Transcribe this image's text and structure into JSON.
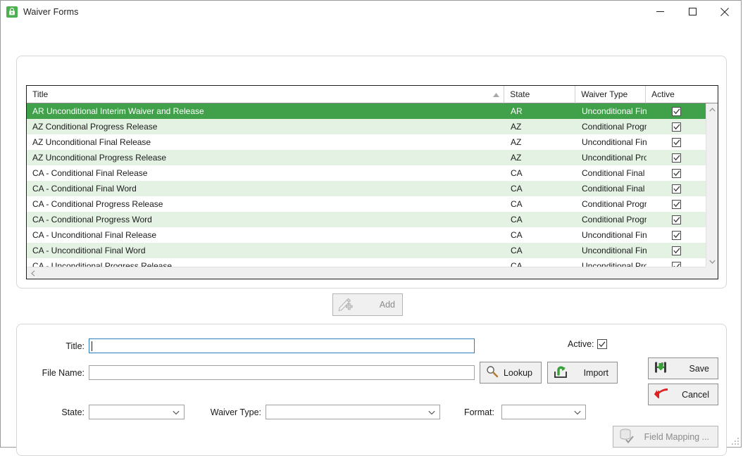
{
  "window": {
    "title": "Waiver Forms",
    "icon": "waiver-lock-icon",
    "minimize_label": "—",
    "maximize_label": "□",
    "close_label": "✕"
  },
  "grid": {
    "columns": [
      {
        "key": "title",
        "label": "Title",
        "sorted": true,
        "sort_dir": "asc"
      },
      {
        "key": "state",
        "label": "State",
        "sorted": false,
        "sort_dir": ""
      },
      {
        "key": "type",
        "label": "Waiver Type",
        "sorted": false,
        "sort_dir": ""
      },
      {
        "key": "active",
        "label": "Active",
        "sorted": false,
        "sort_dir": ""
      }
    ],
    "rows": [
      {
        "title": "AR Unconditional Interim Waiver and Release",
        "state": "AR",
        "type": "Unconditional Final",
        "active": true,
        "selected": true
      },
      {
        "title": "AZ Conditional Progress Release",
        "state": "AZ",
        "type": "Conditional Progr...",
        "active": true,
        "selected": false
      },
      {
        "title": "AZ Unconditional Final Release",
        "state": "AZ",
        "type": "Unconditional Final",
        "active": true,
        "selected": false
      },
      {
        "title": "AZ Unconditional Progress Release",
        "state": "AZ",
        "type": "Unconditional Pro...",
        "active": true,
        "selected": false
      },
      {
        "title": "CA - Conditional Final Release",
        "state": "CA",
        "type": "Conditional Final",
        "active": true,
        "selected": false
      },
      {
        "title": "CA - Conditional Final Word",
        "state": "CA",
        "type": "Conditional Final",
        "active": true,
        "selected": false
      },
      {
        "title": "CA - Conditional Progress Release",
        "state": "CA",
        "type": "Conditional Progr...",
        "active": true,
        "selected": false
      },
      {
        "title": "CA - Conditional Progress Word",
        "state": "CA",
        "type": "Conditional Progr...",
        "active": true,
        "selected": false
      },
      {
        "title": "CA - Unconditional Final Release",
        "state": "CA",
        "type": "Unconditional Final",
        "active": true,
        "selected": false
      },
      {
        "title": "CA - Unconditional Final Word",
        "state": "CA",
        "type": "Unconditional Final",
        "active": true,
        "selected": false
      },
      {
        "title": "CA - Unconditional Progress Release",
        "state": "CA",
        "type": "Unconditional Pro",
        "active": true,
        "selected": false
      }
    ],
    "selected_color": "#40a14a",
    "alt_row_color": "#e4f2e3"
  },
  "toolbar": {
    "add_label": "Add",
    "add_icon": "pen-plus-icon",
    "add_enabled": false
  },
  "form": {
    "title_label": "Title:",
    "title_value": "",
    "file_name_label": "File Name:",
    "file_name_value": "",
    "state_label": "State:",
    "state_value": "",
    "waiver_type_label": "Waiver Type:",
    "waiver_type_value": "",
    "format_label": "Format:",
    "format_value": "",
    "active_label": "Active:",
    "active_checked": true,
    "lookup_label": "Lookup",
    "lookup_icon": "magnifier-icon",
    "import_label": "Import",
    "import_icon": "import-arrow-icon",
    "save_label": "Save",
    "save_icon": "floppy-disk-icon",
    "cancel_label": "Cancel",
    "cancel_icon": "red-arrow-icon",
    "field_mapping_label": "Field Mapping ...",
    "field_mapping_icon": "database-check-icon",
    "field_mapping_enabled": false
  }
}
